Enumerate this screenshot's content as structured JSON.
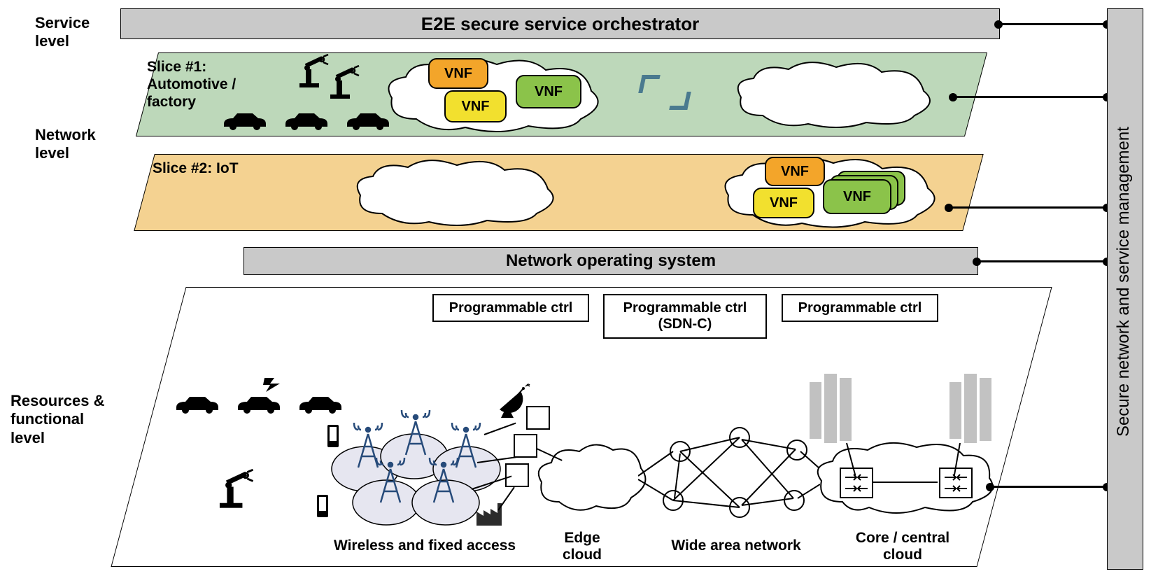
{
  "labels": {
    "service_level": "Service\nlevel",
    "network_level": "Network\nlevel",
    "resources_level": "Resources &\nfunctional\nlevel"
  },
  "bars": {
    "orchestrator": "E2E secure service orchestrator",
    "nos": "Network operating system",
    "vbar": "Secure network and service management"
  },
  "slice1": {
    "title": "Slice #1:\nAutomotive /\nfactory",
    "vnf": [
      "VNF",
      "VNF",
      "VNF"
    ]
  },
  "slice2": {
    "title": "Slice #2: IoT",
    "vnf": [
      "VNF",
      "VNF",
      "VNF"
    ]
  },
  "resources": {
    "ctrl1": "Programmable ctrl",
    "ctrl2": "Programmable ctrl\n(SDN-C)",
    "ctrl3": "Programmable ctrl",
    "captions": {
      "access": "Wireless and fixed access",
      "edge": "Edge\ncloud",
      "wan": "Wide area network",
      "core": "Core / central\ncloud"
    }
  }
}
